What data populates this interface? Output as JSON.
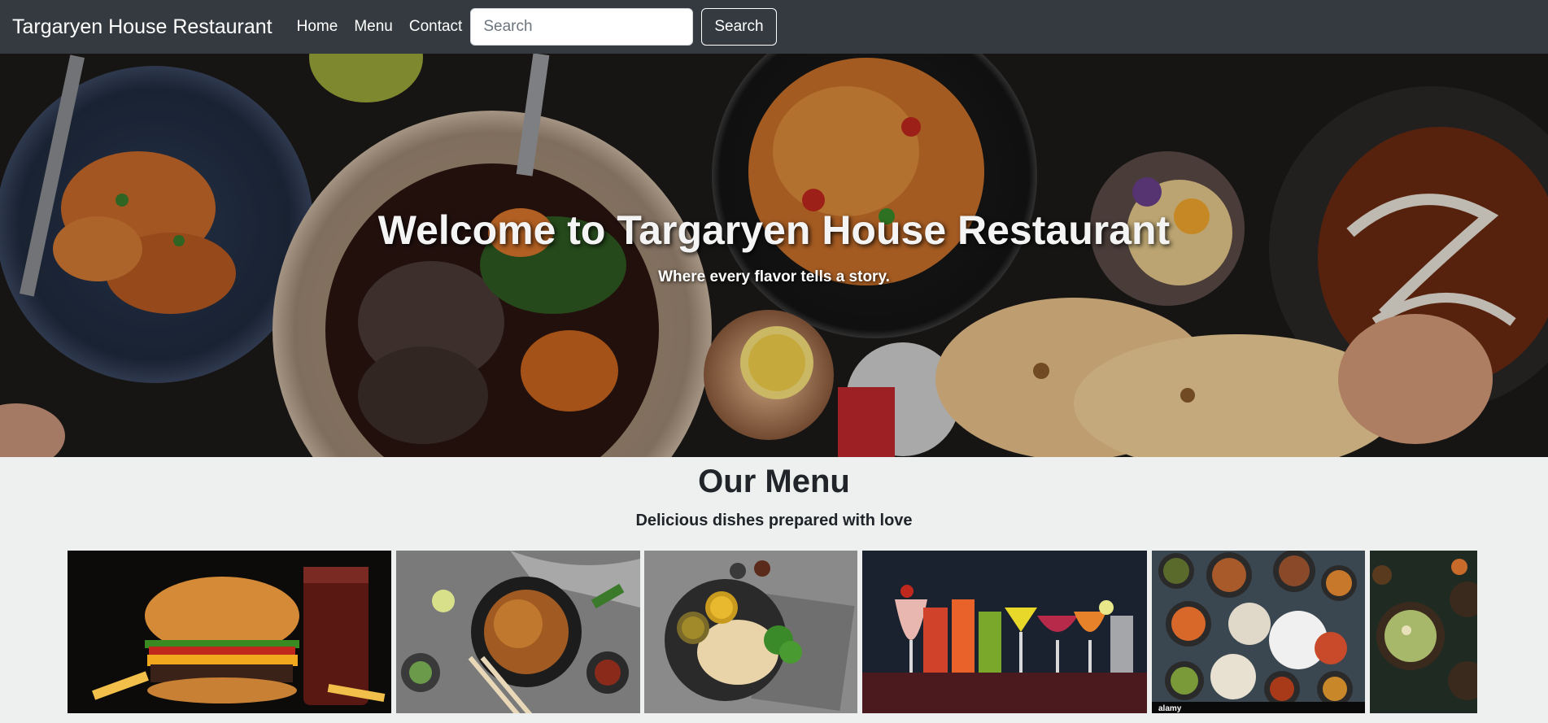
{
  "navbar": {
    "brand": "Targaryen House Restaurant",
    "links": [
      {
        "label": "Home"
      },
      {
        "label": "Menu"
      },
      {
        "label": "Contact"
      }
    ],
    "search": {
      "placeholder": "Search",
      "value": "",
      "button_label": "Search"
    }
  },
  "hero": {
    "title": "Welcome to Targaryen House Restaurant",
    "subtitle": "Where every flavor tells a story."
  },
  "menu": {
    "title": "Our Menu",
    "subtitle": "Delicious dishes prepared with love",
    "images": [
      {
        "icon": "burger-fries-photo"
      },
      {
        "icon": "noodles-bowl-photo"
      },
      {
        "icon": "flatbread-dips-photo"
      },
      {
        "icon": "cocktails-photo"
      },
      {
        "icon": "spread-of-dishes-photo",
        "watermark": "alamy"
      },
      {
        "icon": "soup-bowl-photo"
      }
    ]
  },
  "colors": {
    "navbar_bg": "#343a40",
    "page_bg": "#eef0ef",
    "text_dark": "#212529"
  }
}
